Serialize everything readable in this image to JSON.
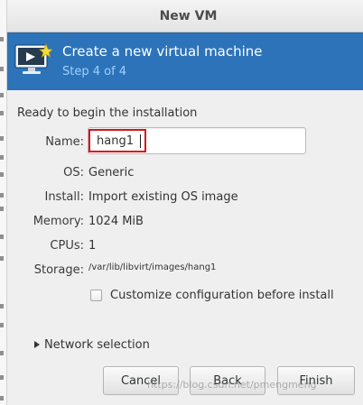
{
  "window": {
    "title": "New VM"
  },
  "banner": {
    "title": "Create a new virtual machine",
    "step": "Step 4 of 4",
    "icon": "monitor-with-star-icon",
    "background": "#2d73b9",
    "step_color": "#9fd0ff"
  },
  "summary": {
    "heading": "Ready to begin the installation",
    "name_label": "Name:",
    "name_value": "hang1",
    "os_label": "OS:",
    "os_value": "Generic",
    "install_label": "Install:",
    "install_value": "Import existing OS image",
    "memory_label": "Memory:",
    "memory_value": "1024 MiB",
    "cpus_label": "CPUs:",
    "cpus_value": "1",
    "storage_label": "Storage:",
    "storage_value": "/var/lib/libvirt/images/hang1"
  },
  "options": {
    "customize_label": "Customize configuration before install",
    "customize_checked": false,
    "network_label": "Network selection"
  },
  "buttons": {
    "cancel": "Cancel",
    "back": "Back",
    "finish": "Finish"
  },
  "watermark": "https://blog.csdn.net/pmengmeng",
  "colors": {
    "highlight": "#d4161d"
  }
}
